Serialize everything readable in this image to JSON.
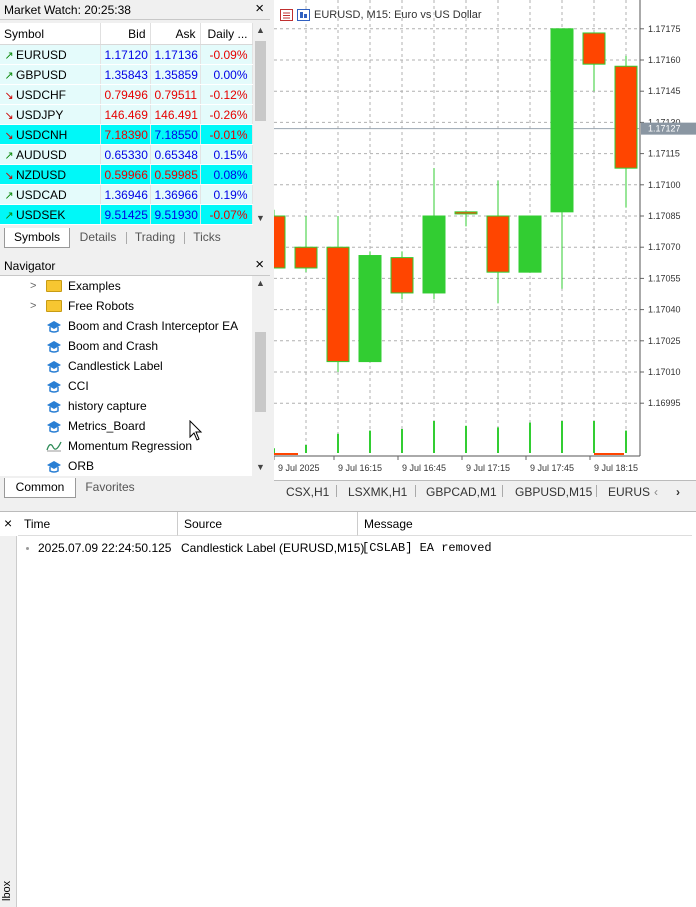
{
  "market_watch": {
    "title": "Market Watch: 20:25:38",
    "close": "×",
    "columns": [
      "Symbol",
      "Bid",
      "Ask",
      "Daily ..."
    ],
    "rows": [
      {
        "arrow": "↗",
        "dir": "up",
        "symbol": "EURUSD",
        "bid": "1.17120",
        "ask": "1.17136",
        "daily": "-0.09%",
        "bid_color": "blue",
        "ask_color": "blue",
        "style": "r-light"
      },
      {
        "arrow": "↗",
        "dir": "up",
        "symbol": "GBPUSD",
        "bid": "1.35843",
        "ask": "1.35859",
        "daily": "0.00%",
        "bid_color": "blue",
        "ask_color": "blue",
        "style": "r-light"
      },
      {
        "arrow": "↘",
        "dir": "dn",
        "symbol": "USDCHF",
        "bid": "0.79496",
        "ask": "0.79511",
        "daily": "-0.12%",
        "bid_color": "red",
        "ask_color": "red",
        "style": "r-light"
      },
      {
        "arrow": "↘",
        "dir": "dn",
        "symbol": "USDJPY",
        "bid": "146.469",
        "ask": "146.491",
        "daily": "-0.26%",
        "bid_color": "red",
        "ask_color": "red",
        "style": "r-light"
      },
      {
        "arrow": "↘",
        "dir": "dn",
        "symbol": "USDCNH",
        "bid": "7.18390",
        "ask": "7.18550",
        "daily": "-0.01%",
        "bid_color": "red",
        "ask_color": "blue",
        "style": "r-cyan"
      },
      {
        "arrow": "↗",
        "dir": "up",
        "symbol": "AUDUSD",
        "bid": "0.65330",
        "ask": "0.65348",
        "daily": "0.15%",
        "bid_color": "blue",
        "ask_color": "blue",
        "style": "r-light"
      },
      {
        "arrow": "↘",
        "dir": "dn",
        "symbol": "NZDUSD",
        "bid": "0.59966",
        "ask": "0.59985",
        "daily": "0.08%",
        "bid_color": "red",
        "ask_color": "red",
        "style": "r-cyan"
      },
      {
        "arrow": "↗",
        "dir": "up",
        "symbol": "USDCAD",
        "bid": "1.36946",
        "ask": "1.36966",
        "daily": "0.19%",
        "bid_color": "blue",
        "ask_color": "blue",
        "style": "r-light"
      },
      {
        "arrow": "↗",
        "dir": "up",
        "symbol": "USDSEK",
        "bid": "9.51425",
        "ask": "9.51930",
        "daily": "-0.07%",
        "bid_color": "blue",
        "ask_color": "blue",
        "style": "r-cyan"
      }
    ],
    "tabs": [
      "Symbols",
      "Details",
      "Trading",
      "Ticks"
    ]
  },
  "navigator": {
    "title": "Navigator",
    "close": "×",
    "items": [
      {
        "type": "folder",
        "label": "Examples"
      },
      {
        "type": "folder",
        "label": "Free Robots"
      },
      {
        "type": "robot",
        "label": "Boom and Crash Interceptor EA"
      },
      {
        "type": "robot",
        "label": "Boom and Crash"
      },
      {
        "type": "robot",
        "label": "Candlestick Label"
      },
      {
        "type": "robot",
        "label": "CCI"
      },
      {
        "type": "robot",
        "label": "history capture"
      },
      {
        "type": "robot",
        "label": "Metrics_Board"
      },
      {
        "type": "indicator",
        "label": "Momentum Regression"
      },
      {
        "type": "robot",
        "label": "ORB"
      }
    ],
    "tabs": [
      "Common",
      "Favorites"
    ]
  },
  "chart": {
    "title": "EURUSD, M15:  Euro vs US Dollar",
    "current_price": "1.17127",
    "up_color": "#32cd32",
    "down_color": "#ff4500",
    "tabs": [
      "CSX,H1",
      "LSXMK,H1",
      "GBPCAD,M1",
      "GBPUSD,M15",
      "EURUS"
    ],
    "scroll_left": "‹",
    "scroll_right": "›"
  },
  "chart_data": {
    "type": "candlestick",
    "symbol": "EURUSD",
    "timeframe": "M15",
    "ylim": [
      1.16985,
      1.17185
    ],
    "y_ticks": [
      "1.17175",
      "1.17160",
      "1.17145",
      "1.17130",
      "1.17115",
      "1.17100",
      "1.17085",
      "1.17070",
      "1.17055",
      "1.17040",
      "1.17025",
      "1.17010",
      "1.16995"
    ],
    "x_labels": [
      "9 Jul 2025",
      "9 Jul 16:15",
      "9 Jul 16:45",
      "9 Jul 17:15",
      "9 Jul 17:45",
      "9 Jul 18:15"
    ],
    "candles": [
      {
        "open": 1.17085,
        "high": 1.17088,
        "low": 1.1706,
        "close": 1.1706
      },
      {
        "open": 1.1707,
        "high": 1.17085,
        "low": 1.17058,
        "close": 1.1706
      },
      {
        "open": 1.1707,
        "high": 1.17085,
        "low": 1.1701,
        "close": 1.17015
      },
      {
        "open": 1.17015,
        "high": 1.17068,
        "low": 1.17015,
        "close": 1.17066
      },
      {
        "open": 1.17065,
        "high": 1.17068,
        "low": 1.17045,
        "close": 1.17048
      },
      {
        "open": 1.17048,
        "high": 1.17108,
        "low": 1.17045,
        "close": 1.17085
      },
      {
        "open": 1.17087,
        "high": 1.17087,
        "low": 1.1708,
        "close": 1.17086
      },
      {
        "open": 1.17085,
        "high": 1.17102,
        "low": 1.17043,
        "close": 1.17058
      },
      {
        "open": 1.17058,
        "high": 1.17085,
        "low": 1.17058,
        "close": 1.17085
      },
      {
        "open": 1.17087,
        "high": 1.17175,
        "low": 1.1705,
        "close": 1.17175
      },
      {
        "open": 1.17173,
        "high": 1.17173,
        "low": 1.17145,
        "close": 1.17158
      },
      {
        "open": 1.17157,
        "high": 1.17162,
        "low": 1.17089,
        "close": 1.17108
      }
    ],
    "volumes": [
      0.15,
      0.25,
      0.6,
      0.7,
      0.75,
      1.0,
      0.85,
      0.8,
      0.95,
      1.0,
      1.0,
      0.7
    ]
  },
  "log": {
    "columns": [
      "Time",
      "Source",
      "Message"
    ],
    "rows": [
      {
        "time": "2025.07.09 22:24:50.125",
        "source": "Candlestick Label (EURUSD,M15)",
        "message": "[CSLAB] EA removed"
      }
    ],
    "side_label": "lbox"
  }
}
